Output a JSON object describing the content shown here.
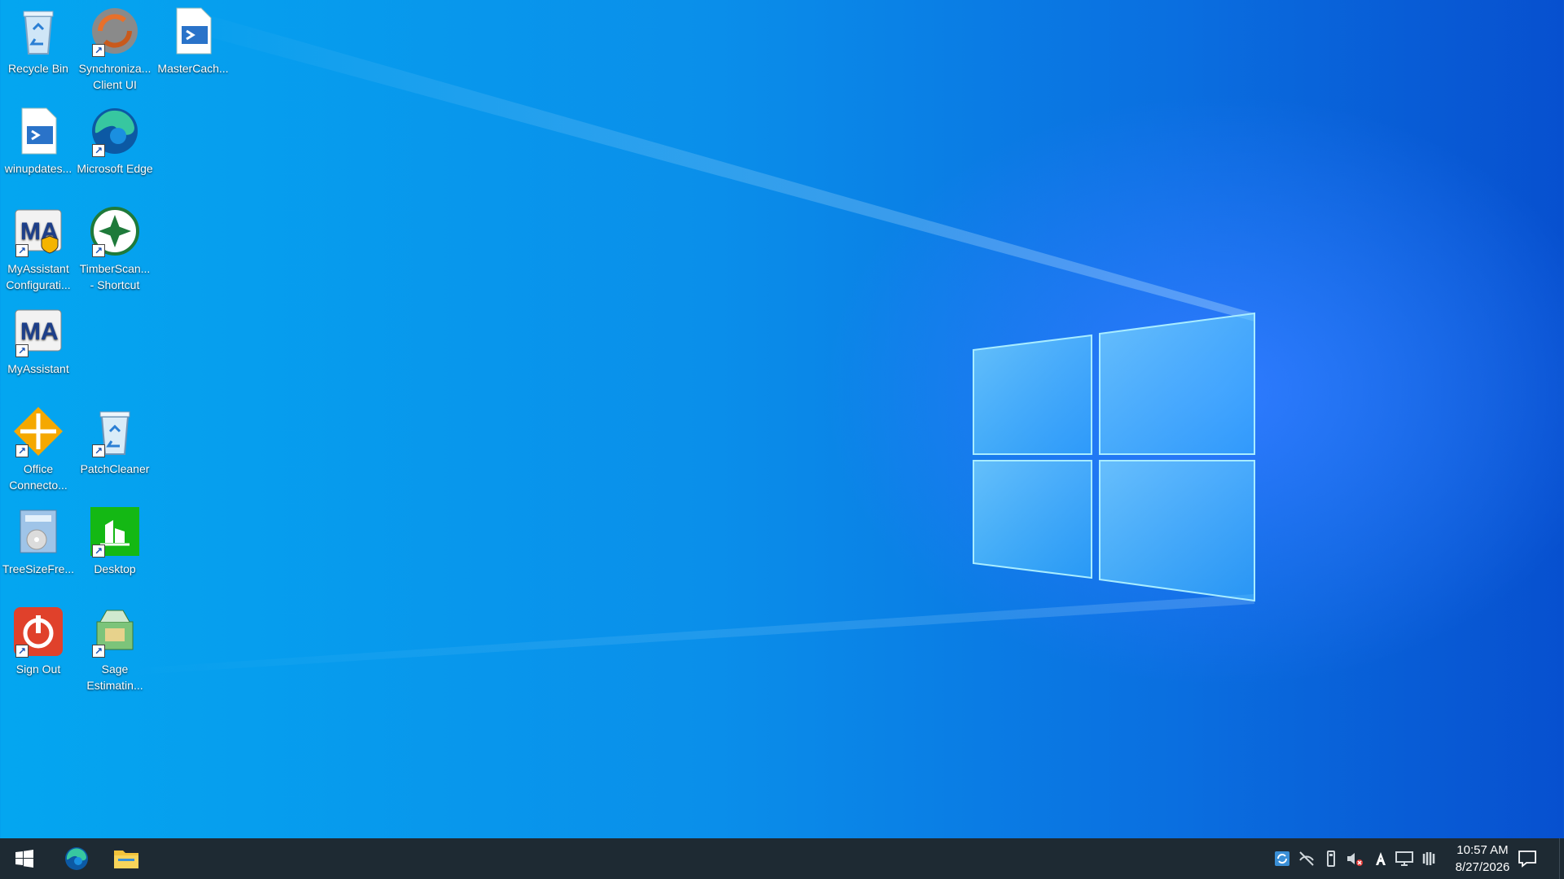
{
  "desktop": {
    "icons": [
      {
        "label": "Recycle Bin"
      },
      {
        "label": "Synchroniza... Client UI"
      },
      {
        "label": "MasterCach..."
      },
      {
        "label": "winupdates..."
      },
      {
        "label": "Microsoft Edge"
      },
      {
        "label": "MyAssistant Configurati..."
      },
      {
        "label": "TimberScan... - Shortcut"
      },
      {
        "label": "MyAssistant"
      },
      {
        "label": "Office Connecto..."
      },
      {
        "label": "PatchCleaner"
      },
      {
        "label": "TreeSizeFre..."
      },
      {
        "label": "Desktop"
      },
      {
        "label": "Sign Out"
      },
      {
        "label": "Sage Estimatin..."
      }
    ]
  },
  "taskbar": {
    "start_icon": "windows-logo-icon",
    "pinned": [
      "edge-icon",
      "file-explorer-icon"
    ],
    "tray_icons": [
      "sync-tray-icon",
      "network-disconnected-icon",
      "usb-icon",
      "volume-muted-icon",
      "language-icon",
      "display-icon",
      "pen-icon"
    ],
    "clock": {
      "time": "10:57 AM",
      "date": "8/27/2026"
    }
  },
  "colors": {
    "taskbar_bg": "#1e2a33",
    "wallpaper_accent": "#0a8fea"
  }
}
